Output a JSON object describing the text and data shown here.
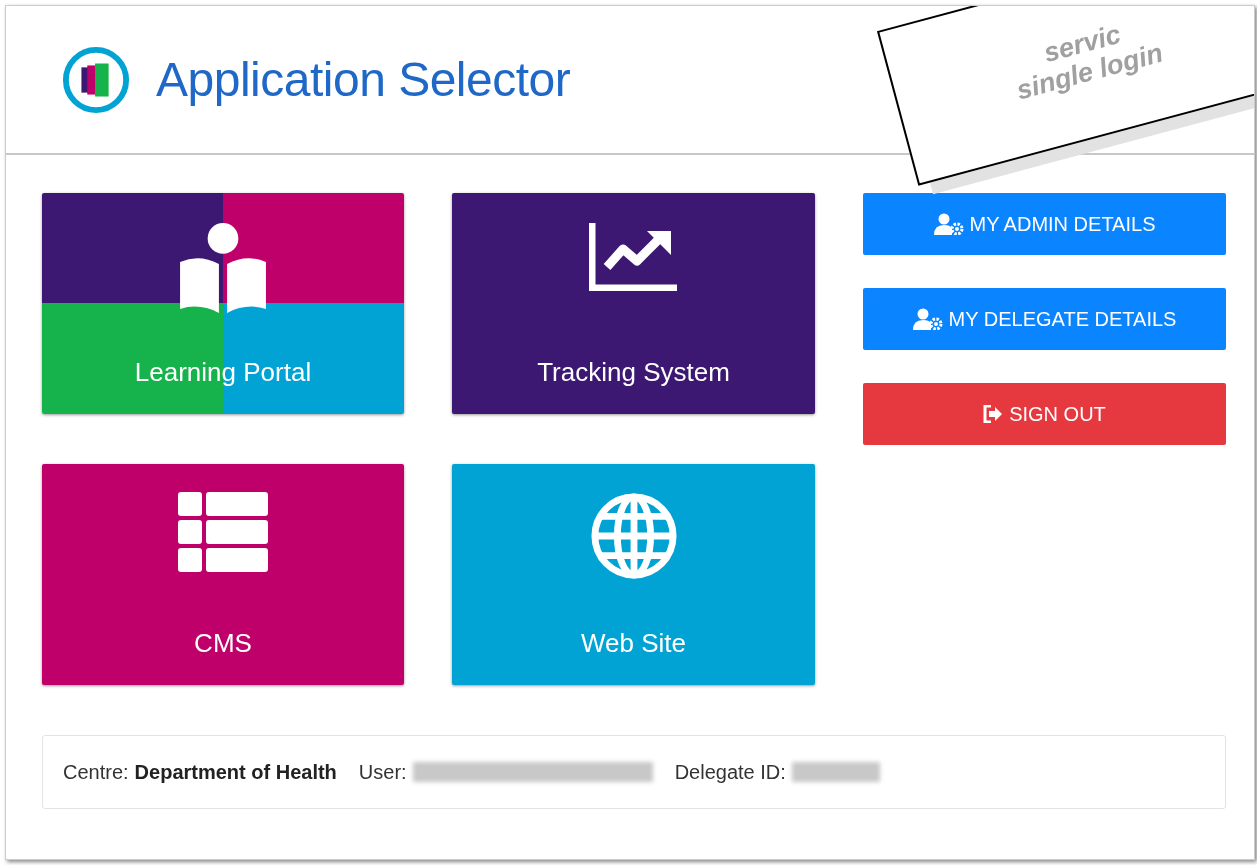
{
  "header": {
    "title": "Application Selector"
  },
  "tiles": [
    {
      "label": "Learning Portal",
      "kind": "quadrant"
    },
    {
      "label": "Tracking System",
      "kind": "solid",
      "color": "#3c1873"
    },
    {
      "label": "CMS",
      "kind": "solid",
      "color": "#c0006a"
    },
    {
      "label": "Web Site",
      "kind": "solid",
      "color": "#00a3d4"
    }
  ],
  "buttons": [
    {
      "label": "MY ADMIN DETAILS",
      "kind": "primary"
    },
    {
      "label": "MY DELEGATE DETAILS",
      "kind": "primary"
    },
    {
      "label": "SIGN OUT",
      "kind": "danger"
    }
  ],
  "footer": {
    "centre_label": "Centre:",
    "centre": "Department of Health",
    "user_label": "User:",
    "delegate_label": "Delegate ID:"
  },
  "callout": {
    "lines": [
      "servic",
      "single login"
    ]
  }
}
